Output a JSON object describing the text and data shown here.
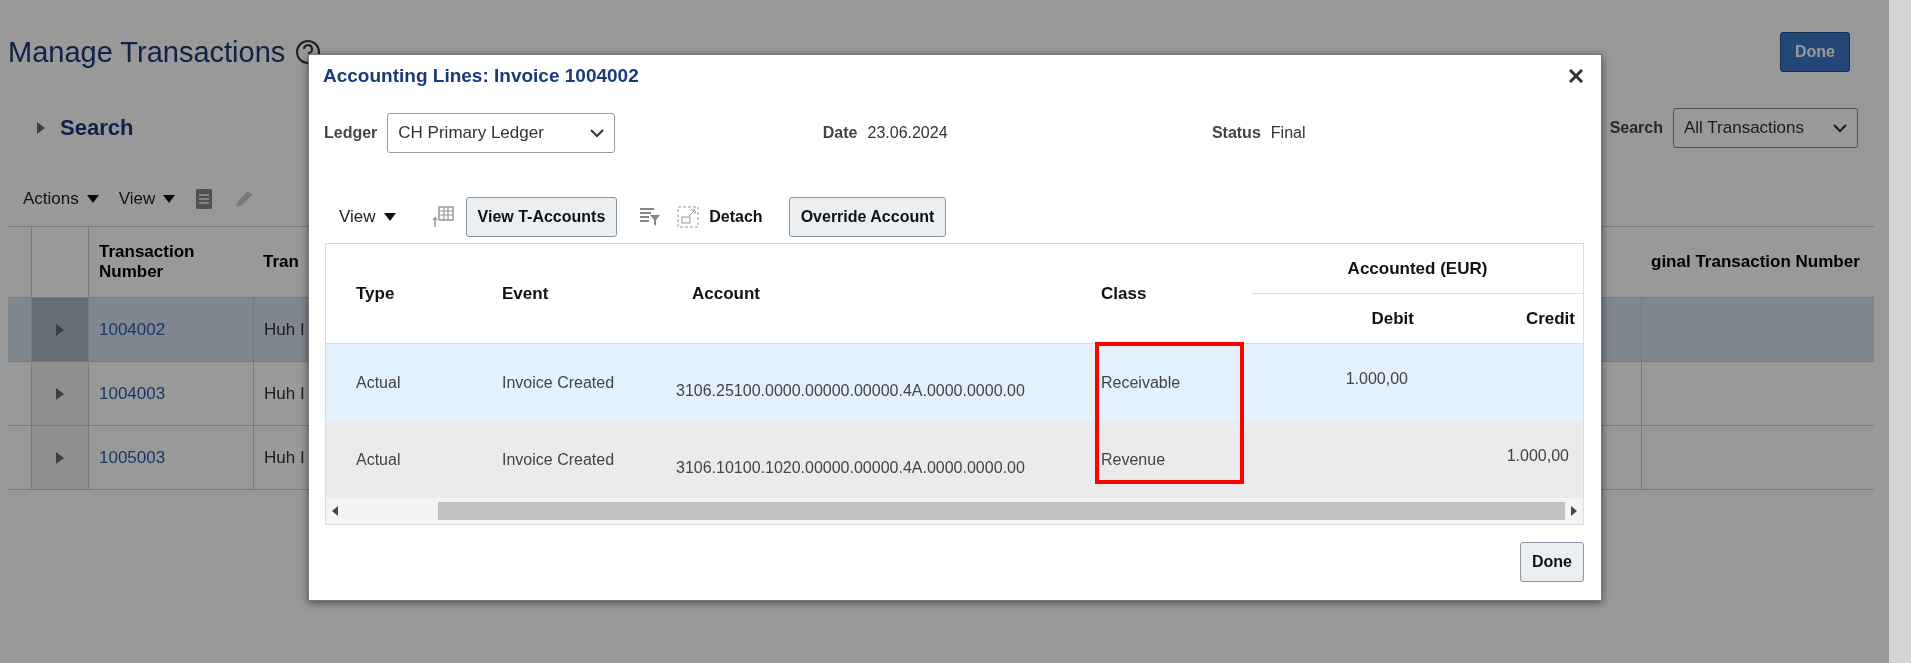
{
  "page": {
    "title": "Manage Transactions",
    "done_button": "Done",
    "search_section": {
      "label": "Search",
      "expanded": false
    },
    "saved_search": {
      "label": "Search",
      "value": "All Transactions"
    },
    "toolbar": {
      "actions": "Actions",
      "view": "View"
    },
    "table": {
      "columns": [
        "Transaction Number",
        "Tran",
        "ginal Transaction Number"
      ],
      "rows": [
        {
          "number": "1004002",
          "column_2": "Huh I",
          "selected": true
        },
        {
          "number": "1004003",
          "column_2": "Huh I",
          "selected": false
        },
        {
          "number": "1005003",
          "column_2": "Huh I",
          "selected": false
        }
      ]
    }
  },
  "dialog": {
    "title": "Accounting Lines: Invoice 1004002",
    "ledger": {
      "label": "Ledger",
      "value": "CH Primary Ledger"
    },
    "date": {
      "label": "Date",
      "value": "23.06.2024"
    },
    "status": {
      "label": "Status",
      "value": "Final"
    },
    "toolbar": {
      "view": "View",
      "t_accounts": "View T-Accounts",
      "detach": "Detach",
      "override": "Override Account"
    },
    "table": {
      "group_header": "Accounted (EUR)",
      "columns": [
        "Type",
        "Event",
        "Account",
        "Class",
        "Debit",
        "Credit"
      ],
      "highlight": {
        "kind": "rectangle"
      },
      "rows": [
        {
          "type": "Actual",
          "event": "Invoice Created",
          "account": "3106.25100.0000.00000.00000.4A.0000.0000.00",
          "class": "Receivable",
          "debit": "1.000,00",
          "selected": true
        },
        {
          "type": "Actual",
          "event": "Invoice Created",
          "account": "3106.10100.1020.00000.00000.4A.0000.0000.00",
          "class": "Revenue",
          "credit": "1.000,00",
          "selected": false
        }
      ]
    },
    "done_button": "Done"
  }
}
